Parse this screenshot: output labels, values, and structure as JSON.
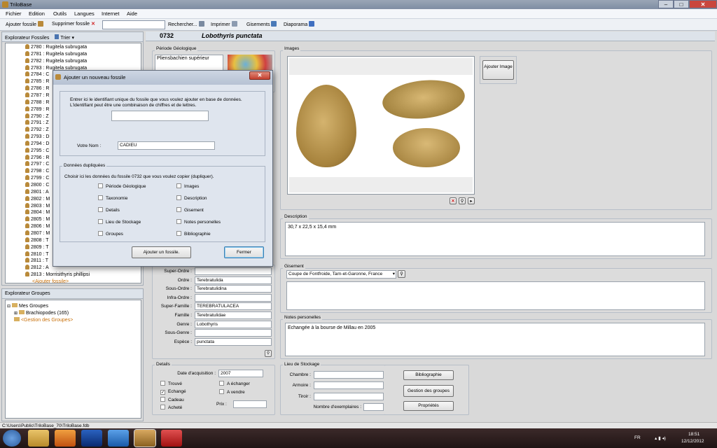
{
  "window": {
    "title": "TriloBase",
    "min": "–",
    "max": "□",
    "close": "✕"
  },
  "menu": [
    "Fichier",
    "Edition",
    "Outils",
    "Langues",
    "Internet",
    "Aide"
  ],
  "toolbar": {
    "add": "Ajouter fossile",
    "delete": "Supprimer fossile",
    "search": "Rechercher...",
    "print": "Imprimer",
    "deposits": "Gisements",
    "slideshow": "Diaporama"
  },
  "left": {
    "explorer_title": "Explorateur Fossiles",
    "sort_label": "Trier ▾",
    "items": [
      "2780 : Rugitela subrugata",
      "2781 : Rugitela subrugata",
      "2782 : Rugitela subrugata",
      "2783 : Rugitela subrugata",
      "2784 : C",
      "2785 : R",
      "2786 : R",
      "2787 : R",
      "2788 : R",
      "2789 : R",
      "2790 : Z",
      "2791 : Z",
      "2792 : Z",
      "2793 : D",
      "2794 : D",
      "2795 : C",
      "2796 : R",
      "2797 : C",
      "2798 : C",
      "2799 : C",
      "2800 : C",
      "2801 : A",
      "2802 : M",
      "2803 : M",
      "2804 : M",
      "2805 : M",
      "2806 : M",
      "2807 : M",
      "2808 : T",
      "2809 : T",
      "2810 : T",
      "2811 : T",
      "2812 : A",
      "2813 : Morrisithyris phillipsi"
    ],
    "add_fossil": "<Ajouter fossile>",
    "groups_title": "Explorateur Groupes",
    "my_groups": "Mes Groupes",
    "brachiopods": "Brachiopodes  (165)",
    "manage_groups": "<Gestion des Groupes>"
  },
  "header": {
    "id": "0732",
    "name": "Lobothyris  punctata"
  },
  "period": {
    "title": "Période Géologique",
    "value": "Pliensbachien supérieur"
  },
  "taxonomy": {
    "rows": [
      {
        "label": "Super-Ordre :",
        "value": ""
      },
      {
        "label": "Ordre :",
        "value": "Terebratulida"
      },
      {
        "label": "Sous-Ordre :",
        "value": "Terebratulidina"
      },
      {
        "label": "Infra-Ordre :",
        "value": ""
      },
      {
        "label": "Super-Famille :",
        "value": "TEREBRATULACEA"
      },
      {
        "label": "Famille :",
        "value": "Terebratulidae"
      },
      {
        "label": "Genre :",
        "value": "Lobothyris"
      },
      {
        "label": "Sous-Genre :",
        "value": ""
      },
      {
        "label": "Espèce :",
        "value": "punctata"
      }
    ]
  },
  "details": {
    "title": "Details",
    "date_label": "Date d'acquisition :",
    "date": "2007",
    "trouve": "Trouvé",
    "echange": "Echangé",
    "cadeau": "Cadeau",
    "achete": "Acheté",
    "a_echanger": "A échanger",
    "a_vendre": "A vendre",
    "prix_label": "Prix :"
  },
  "images": {
    "title": "Images",
    "add_button": "Ajouter Image"
  },
  "description": {
    "title": "Description",
    "text": "30,7 x 22,5 x 15,4 mm"
  },
  "gisement": {
    "title": "Gisement",
    "value": "Coupe de Fontfroide, Tarn-et-Garonne, France"
  },
  "notes": {
    "title": "Notes personelles",
    "text": "Echangée à la bourse de Millau en 2005"
  },
  "storage": {
    "title": "Lieu de Stockage",
    "chambre": "Chambre :",
    "armoire": "Armoire :",
    "tiroir": "Tiroir :",
    "exemplaires": "Nombre d'exemplaires :"
  },
  "side_buttons": {
    "bib": "Bibliographie",
    "groups": "Gestion des groupes",
    "props": "Propriétés"
  },
  "dialog": {
    "title": "Ajouter un nouveau fossile",
    "intro1": "Entrer ici le identifiant unique du fossile que vous voulez ajouter en base de données.",
    "intro2": "L'identifiant peut être une combinaison de chiffres et de lettres.",
    "id_value": "",
    "name_label": "Votre Nom :",
    "name_value": "CADIEU",
    "dup_title": "Données dupliquées",
    "dup_text": "Choisir ici les données du fossile 0732 que vous voulez copier (dupliquer).",
    "left_opts": [
      "Période Géologique",
      "Taxonomie",
      "Details",
      "Lieu de Stockage",
      "Groupes"
    ],
    "right_opts": [
      "Images",
      "Description",
      "Gisement",
      "Notes personelles",
      "Bibliographie"
    ],
    "add_btn": "Ajouter un fossile.",
    "close_btn": "Fermer"
  },
  "statusbar": "C:\\Users\\Public\\TriloBase_70\\TriloBase.fdb",
  "tray": {
    "lang": "FR",
    "time": "18:51",
    "date": "12/12/2012"
  },
  "colors": {
    "orange_link": "#c8700a",
    "header_bg": "#dde3ea",
    "taskbar": "#2a1b1b"
  }
}
